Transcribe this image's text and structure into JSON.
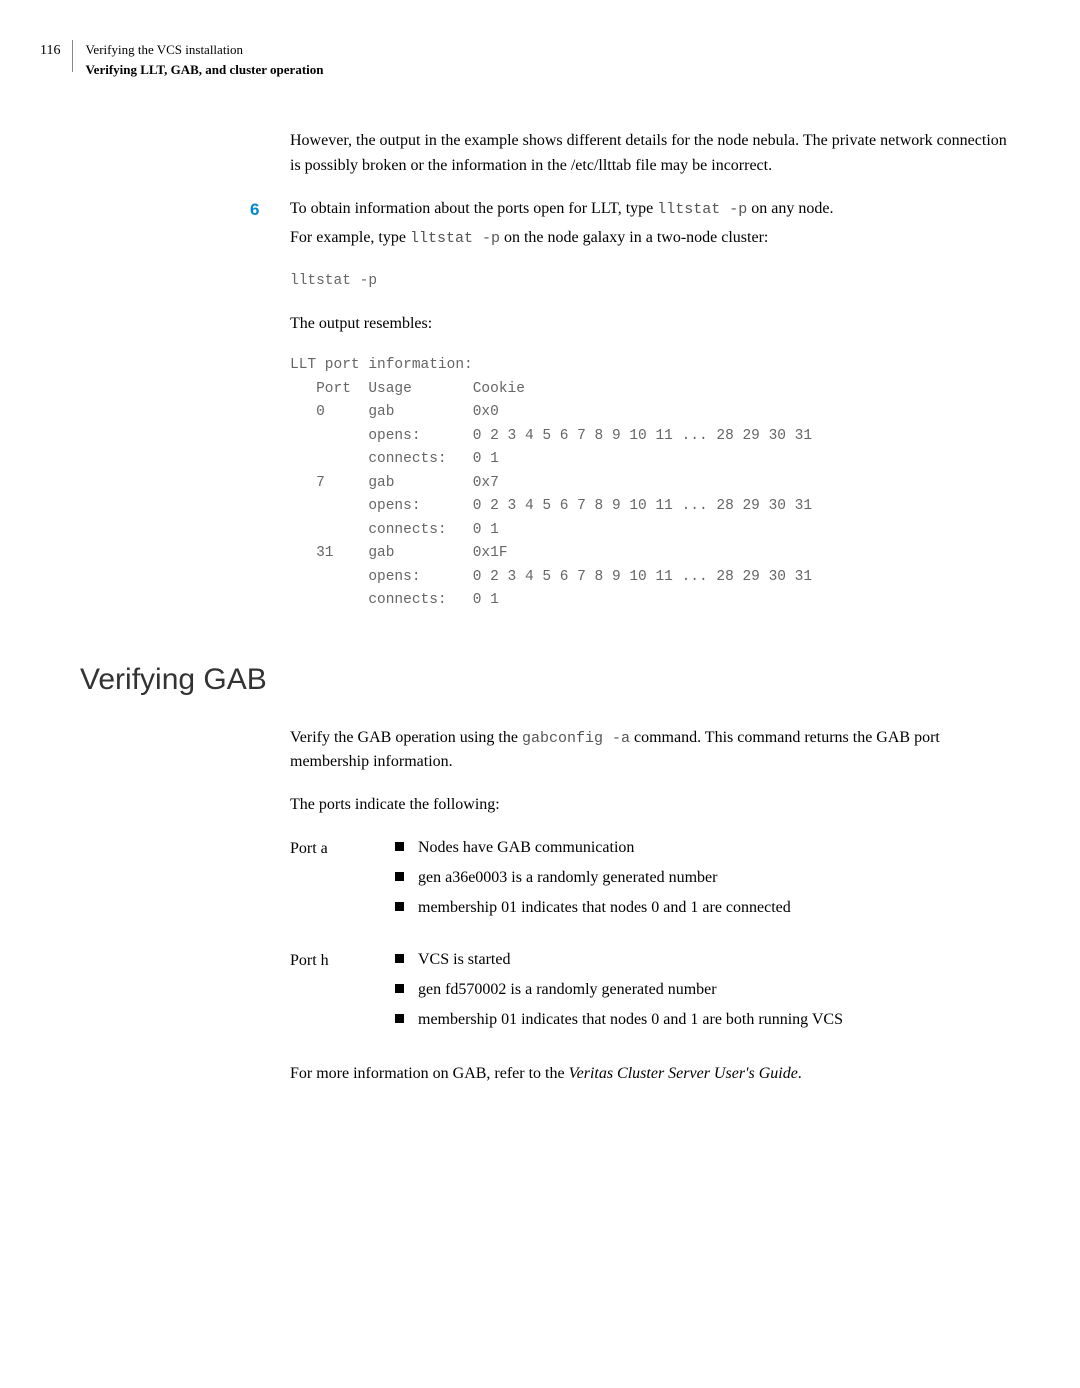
{
  "header": {
    "page_num": "116",
    "title": "Verifying the VCS installation",
    "subtitle": "Verifying LLT, GAB, and cluster operation"
  },
  "para1": "However, the output in the example shows different details for the node nebula. The private network connection is possibly broken or the information in the /etc/llttab file may be incorrect.",
  "step6": {
    "num": "6",
    "text_before": "To obtain information about the ports open for LLT, type ",
    "cmd1": "lltstat -p",
    "text_mid": " on any node.",
    "text2_before": "For example, type ",
    "cmd2": "lltstat -p",
    "text2_after": " on the node galaxy in a two-node cluster:"
  },
  "code_lltstat": "lltstat -p",
  "output_label": "The output resembles:",
  "code_output": "LLT port information:\n   Port  Usage       Cookie\n   0     gab         0x0\n         opens:      0 2 3 4 5 6 7 8 9 10 11 ... 28 29 30 31\n         connects:   0 1\n   7     gab         0x7\n         opens:      0 2 3 4 5 6 7 8 9 10 11 ... 28 29 30 31\n         connects:   0 1\n   31    gab         0x1F\n         opens:      0 2 3 4 5 6 7 8 9 10 11 ... 28 29 30 31\n         connects:   0 1",
  "h2_gab": "Verifying GAB",
  "gab_para1_before": "Verify the GAB operation using the ",
  "gab_cmd": "gabconfig -a",
  "gab_para1_after": " command. This command returns the GAB port membership information.",
  "gab_para2": "The ports indicate the following:",
  "port_a": {
    "label": "Port a",
    "items": [
      "Nodes have GAB communication",
      "gen a36e0003 is a randomly generated number",
      "membership 01 indicates that nodes 0 and 1 are connected"
    ]
  },
  "port_h": {
    "label": "Port h",
    "items": [
      "VCS is started",
      "gen fd570002 is a randomly generated number",
      "membership 01 indicates that nodes 0 and 1 are both running VCS"
    ]
  },
  "footer_before": "For more information on GAB, refer to the ",
  "footer_italic": "Veritas Cluster Server User's Guide",
  "footer_after": "."
}
